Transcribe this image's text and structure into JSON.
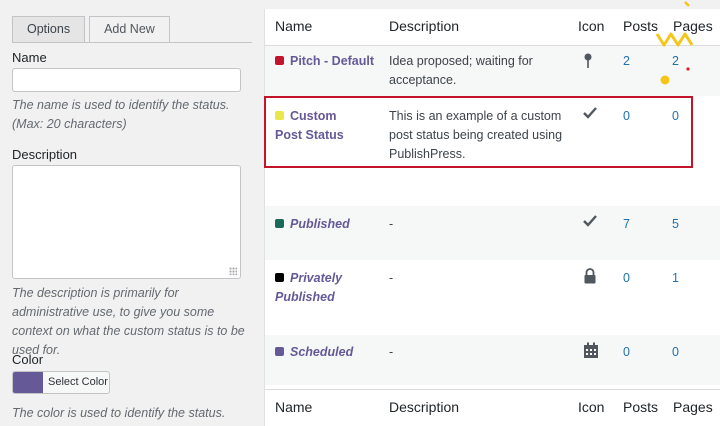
{
  "tabs": [
    {
      "label": "Options"
    },
    {
      "label": "Add New"
    }
  ],
  "form": {
    "name_label": "Name",
    "name_value": "",
    "name_help": "The name is used to identify the status. (Max: 20 characters)",
    "description_label": "Description",
    "description_value": "",
    "description_help": "The description is primarily for administrative use, to give you some context on what the custom status is to be used for.",
    "color_label": "Color",
    "color_button_label": "Select Color",
    "color_value": "#655997",
    "color_help": "The color is used to identify the status."
  },
  "table": {
    "headers": {
      "name": "Name",
      "description": "Description",
      "icon": "Icon",
      "posts": "Posts",
      "pages": "Pages"
    },
    "rows": [
      {
        "name": "Pitch - Default",
        "color": "#c3142b",
        "description": "Idea proposed; waiting for acceptance.",
        "icon": "pin-icon",
        "posts": "2",
        "pages": "2"
      },
      {
        "name": "Custom Post Status",
        "color": "#e8e84a",
        "description": "This is an example of a custom post status being created using PublishPress.",
        "icon": "checkmark-icon",
        "posts": "0",
        "pages": "0"
      },
      {
        "name": "Published",
        "color": "#1a6a5a",
        "description": "-",
        "icon": "checkmark-icon",
        "posts": "7",
        "pages": "5"
      },
      {
        "name": "Privately Published",
        "color": "#000000",
        "description": "-",
        "icon": "lock-icon",
        "posts": "0",
        "pages": "1"
      },
      {
        "name": "Scheduled",
        "color": "#655997",
        "description": "-",
        "icon": "calendar-icon",
        "posts": "0",
        "pages": "0"
      }
    ]
  },
  "highlight_color": "#c3142b"
}
